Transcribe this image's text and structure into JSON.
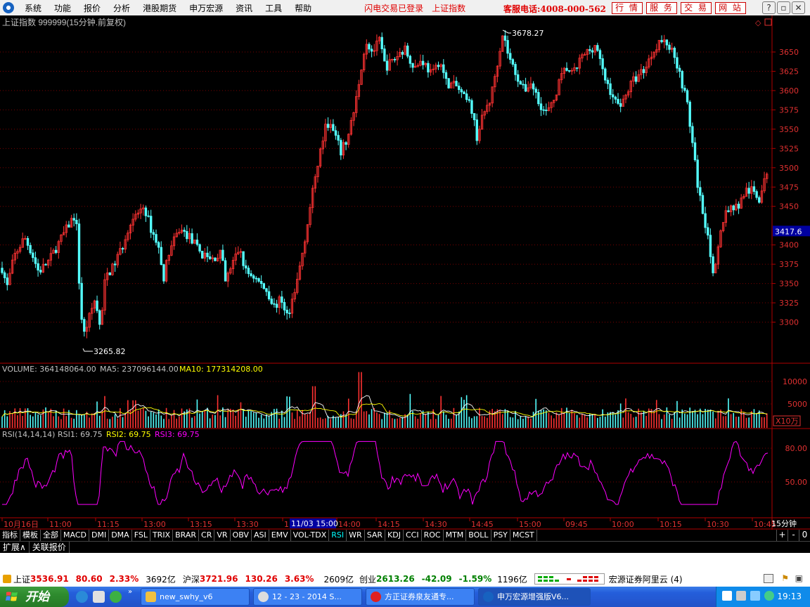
{
  "menu": {
    "items": [
      "系统",
      "功能",
      "报价",
      "分析",
      "港股期货",
      "申万宏源",
      "资讯",
      "工具",
      "帮助"
    ],
    "notice_login": "闪电交易已登录",
    "notice_index": "上证指数",
    "hotline": "客服电话:4008-000-562",
    "right_buttons": [
      "行 情",
      "服 务",
      "交 易",
      "网 站"
    ]
  },
  "chart": {
    "title": "上证指数 999999(15分钟.前复权)",
    "high_label": "3678.27",
    "low_label": "3265.82",
    "current_price": "3417.6",
    "price_ticks": [
      "3650",
      "3625",
      "3600",
      "3575",
      "3550",
      "3525",
      "3500",
      "3475",
      "3450",
      "3400",
      "3375",
      "3350",
      "3325",
      "3300"
    ],
    "volume_header": {
      "volume": "VOLUME: 364148064.00",
      "ma5": "MA5: 237096144.00",
      "ma10": "MA10: 177314208.00"
    },
    "volume_ticks": [
      "10000",
      "5000"
    ],
    "volume_unit": "X10万",
    "rsi_header": {
      "name": "RSI(14,14,14)",
      "rsi1": "RSI1: 69.75",
      "rsi2": "RSI2: 69.75",
      "rsi3": "RSI3: 69.75"
    },
    "rsi_ticks": [
      "80.00",
      "50.00"
    ],
    "time_labels": [
      "10月16日",
      "11:00",
      "11:15",
      "13:00",
      "13:15",
      "13:30",
      "1",
      "14:00",
      "14:15",
      "14:30",
      "14:45",
      "15:00",
      "09:45",
      "10:00",
      "10:15",
      "10:30",
      "10:45"
    ],
    "cursor_time": "11/03 15:00",
    "period": "15分钟"
  },
  "colors": {
    "up": "#ff3232",
    "down": "#54ffff",
    "frame": "#b00000",
    "ma5": "#ffffff",
    "ma10": "#ffff00",
    "rsi": "#ff00ff"
  },
  "tabs": [
    "指标",
    "模板",
    "全部",
    "MACD",
    "DMI",
    "DMA",
    "FSL",
    "TRIX",
    "BRAR",
    "CR",
    "VR",
    "OBV",
    "ASI",
    "EMV",
    "VOL-TDX",
    "RSI",
    "WR",
    "SAR",
    "KDJ",
    "CCI",
    "ROC",
    "MTM",
    "BOLL",
    "PSY",
    "MCST"
  ],
  "tab_right": [
    "+",
    "-",
    "0"
  ],
  "subtabs": [
    "扩展∧",
    "关联报价"
  ],
  "status": {
    "sh_label": "上证",
    "sh_value": "3536.91",
    "sh_change": "80.60",
    "sh_pct": "2.33%",
    "sh_amount": "3692亿",
    "hs_label": "沪深",
    "hs_value": "3721.96",
    "hs_change": "130.26",
    "hs_pct": "3.63%",
    "hs_amount": "2609亿",
    "cy_label": "创业",
    "cy_value": "2613.26",
    "cy_change": "-42.09",
    "cy_pct": "-1.59%",
    "cy_amount": "1196亿",
    "broker": "宏源证券阿里云 (4)"
  },
  "taskbar": {
    "start": "开始",
    "tasks": [
      "new_swhy_v6",
      "12 - 23 - 2014 S...",
      "方正证券泉友通专...",
      "申万宏源增强版V6..."
    ],
    "clock": "19:13"
  }
}
